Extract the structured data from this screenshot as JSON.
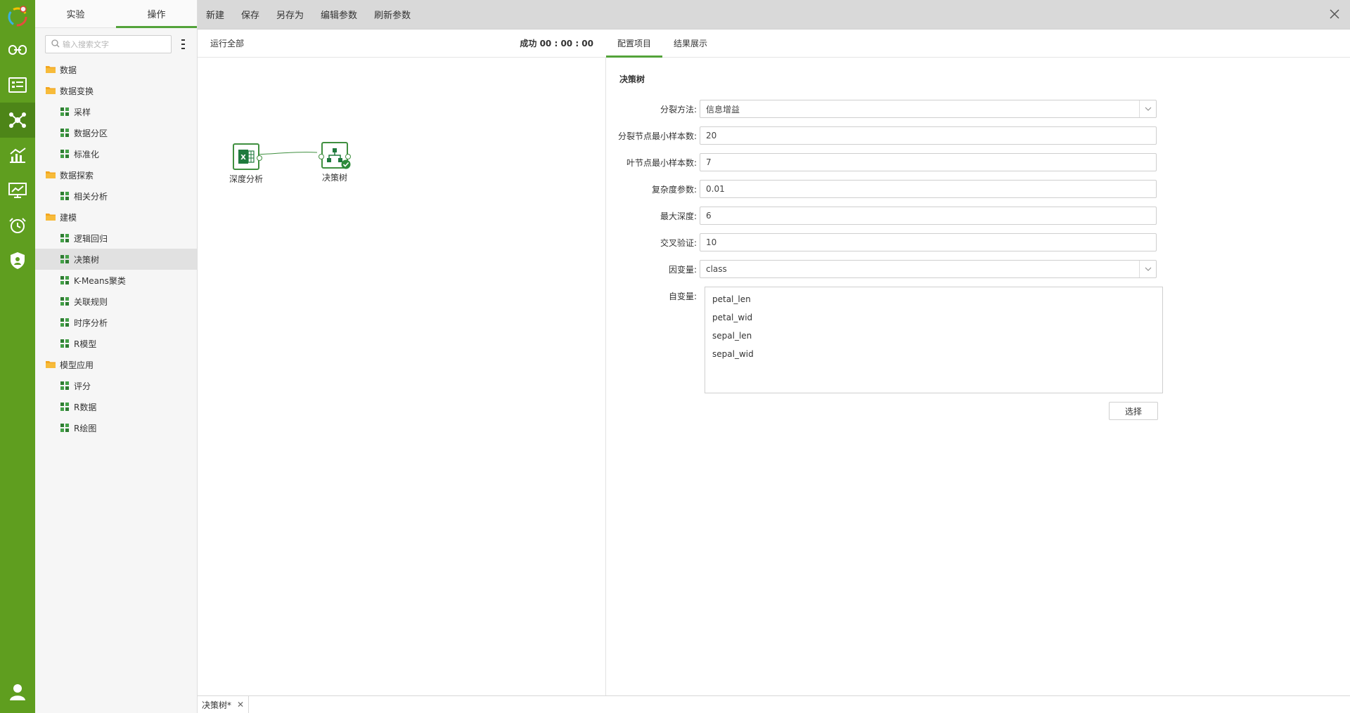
{
  "colors": {
    "rail_bg": "#5f9e1f",
    "accent_green": "#53a33a",
    "node_border": "#3f8f3f"
  },
  "rail": {
    "icons": [
      "app-logo",
      "link-icon",
      "list-card-icon",
      "network-icon",
      "chart-icon",
      "monitor-icon",
      "alarm-clock-icon",
      "shield-user-icon",
      "user-icon"
    ],
    "active": "network-icon"
  },
  "sidebar": {
    "tabs": [
      {
        "label": "实验"
      },
      {
        "label": "操作",
        "active": true
      }
    ],
    "search_placeholder": "输入搜索文字",
    "tree": [
      {
        "type": "folder",
        "label": "数据"
      },
      {
        "type": "folder",
        "label": "数据变换"
      },
      {
        "type": "leaf",
        "label": "采样"
      },
      {
        "type": "leaf",
        "label": "数据分区"
      },
      {
        "type": "leaf",
        "label": "标准化"
      },
      {
        "type": "folder",
        "label": "数据探索"
      },
      {
        "type": "leaf",
        "label": "相关分析"
      },
      {
        "type": "folder",
        "label": "建模"
      },
      {
        "type": "leaf",
        "label": "逻辑回归"
      },
      {
        "type": "leaf",
        "label": "决策树",
        "selected": true
      },
      {
        "type": "leaf",
        "label": "K-Means聚类"
      },
      {
        "type": "leaf",
        "label": "关联规则"
      },
      {
        "type": "leaf",
        "label": "时序分析"
      },
      {
        "type": "leaf",
        "label": "R模型"
      },
      {
        "type": "folder",
        "label": "模型应用"
      },
      {
        "type": "leaf",
        "label": "评分"
      },
      {
        "type": "leaf",
        "label": "R数据"
      },
      {
        "type": "leaf",
        "label": "R绘图"
      }
    ]
  },
  "toolbar": {
    "new": "新建",
    "save": "保存",
    "save_as": "另存为",
    "edit_params": "编辑参数",
    "refresh_params": "刷新参数"
  },
  "canvas": {
    "run_all": "运行全部",
    "status": "成功 00 : 00 : 00",
    "nodes": [
      {
        "label": "深度分析",
        "icon": "excel-icon"
      },
      {
        "label": "决策树",
        "icon": "decision-tree-icon",
        "state": "success"
      }
    ]
  },
  "config": {
    "tabs": [
      {
        "label": "配置项目",
        "active": true
      },
      {
        "label": "结果展示"
      }
    ],
    "section_title": "决策树",
    "fields": {
      "split_method": {
        "label": "分裂方法:",
        "value": "信息增益"
      },
      "min_split_samples": {
        "label": "分裂节点最小样本数:",
        "value": "20"
      },
      "min_leaf_samples": {
        "label": "叶节点最小样本数:",
        "value": "7"
      },
      "complexity": {
        "label": "复杂度参数:",
        "value": "0.01"
      },
      "max_depth": {
        "label": "最大深度:",
        "value": "6"
      },
      "cross_validation": {
        "label": "交叉验证:",
        "value": "10"
      },
      "dependent_var": {
        "label": "因变量:",
        "value": "class"
      },
      "independent_vars": {
        "label": "自变量:",
        "items": [
          "petal_len",
          "petal_wid",
          "sepal_len",
          "sepal_wid"
        ]
      }
    },
    "select_button": "选择"
  },
  "bottom_tabs": [
    {
      "label": "决策树*"
    }
  ]
}
